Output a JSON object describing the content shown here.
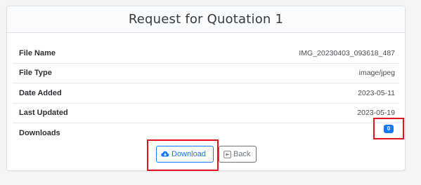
{
  "card": {
    "title": "Request for Quotation 1"
  },
  "details": [
    {
      "label": "File Name",
      "value": "IMG_20230403_093618_487"
    },
    {
      "label": "File Type",
      "value": "image/jpeg"
    },
    {
      "label": "Date Added",
      "value": "2023-05-11"
    },
    {
      "label": "Last Updated",
      "value": "2023-05-19"
    },
    {
      "label": "Downloads",
      "value": "0"
    }
  ],
  "actions": {
    "download_label": "Download",
    "back_label": "Back"
  },
  "colors": {
    "primary": "#1479f7",
    "secondary": "#6c757d",
    "highlight": "#e0141c"
  },
  "icons": {
    "download": "cloud-download-icon",
    "back": "arrow-left-square-icon"
  }
}
